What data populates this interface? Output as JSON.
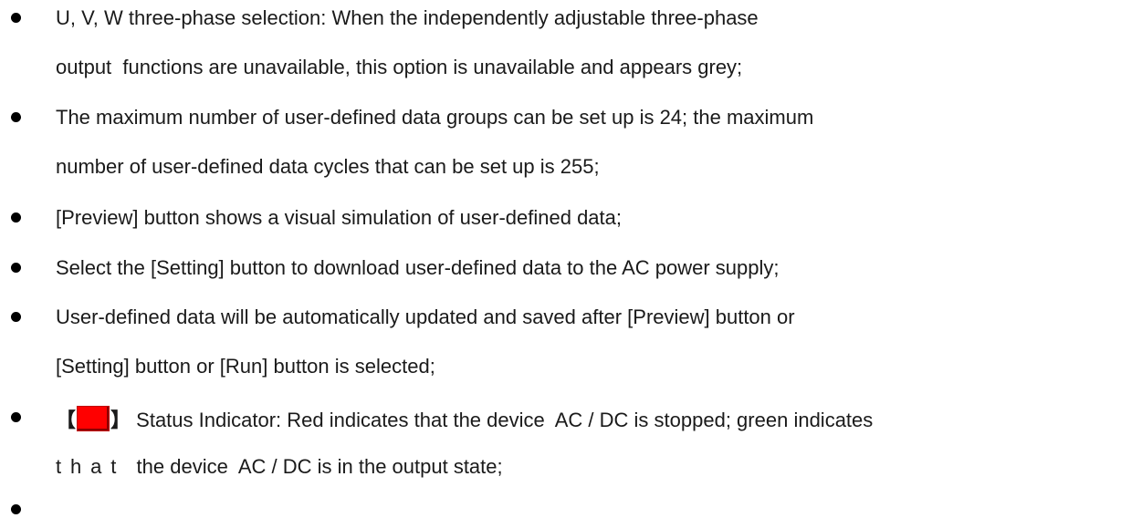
{
  "document": {
    "bullets": [
      {
        "lines": [
          "U, V, W three-phase selection: When the independently adjustable three-phase",
          "output  functions are unavailable, this option is unavailable and appears grey;"
        ]
      },
      {
        "lines": [
          "The maximum number of user-defined data groups can be set up is 24; the maximum",
          "number of user-defined data cycles that can be set up is 255;"
        ]
      },
      {
        "lines": [
          "[Preview] button shows a visual simulation of user-defined data;"
        ]
      },
      {
        "lines": [
          "Select the [Setting] button to download user-defined data to the AC power supply;"
        ]
      },
      {
        "lines": [
          "User-defined data will be automatically updated and saved after [Preview] button or",
          "[Setting] button or [Run] button is selected;"
        ]
      },
      {
        "bracket_open": "【",
        "bracket_close": "】",
        "indicator_color": "#ff0000",
        "line1_text": "Status Indicator: Red indicates that the device  AC / DC is stopped; green indicates",
        "line2_spaced": "that",
        "line2_rest": "  the device  AC / DC is in the output state;"
      },
      {
        "lines": []
      }
    ]
  }
}
